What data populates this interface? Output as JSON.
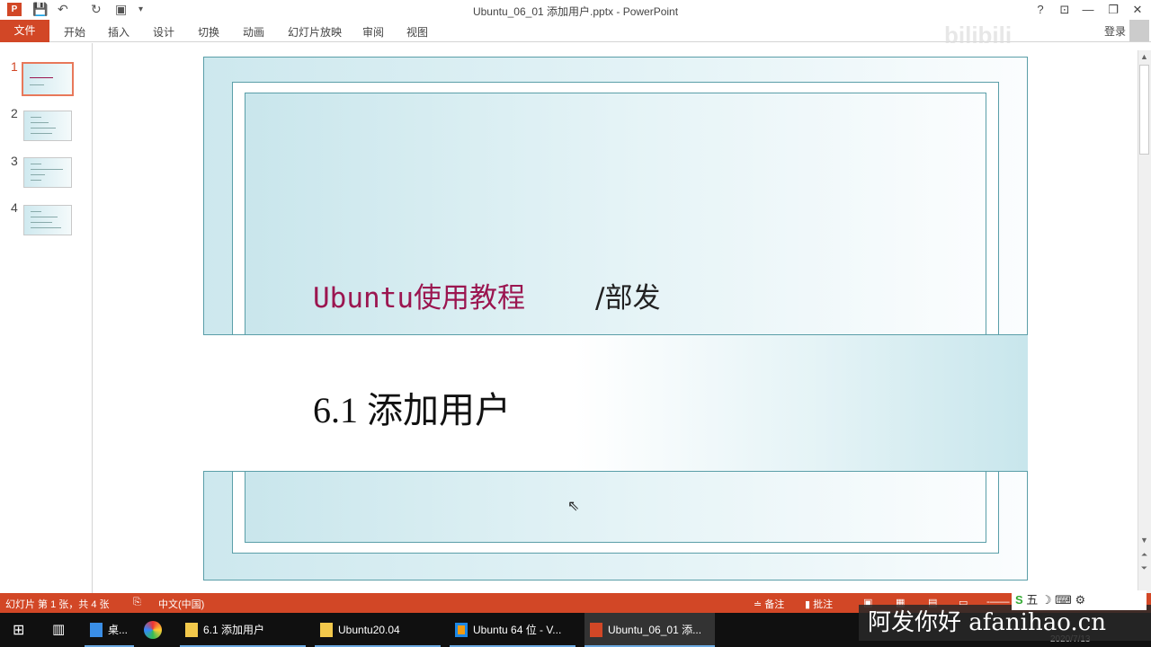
{
  "window": {
    "title": "Ubuntu_06_01 添加用户.pptx - PowerPoint",
    "help": "?",
    "minimize": "—",
    "restore": "❐",
    "close": "✕",
    "ribbon_display": "⊡"
  },
  "quick_access": {
    "save": "💾",
    "undo": "↶",
    "redo": "↻",
    "present": "▣",
    "more": "▾"
  },
  "ribbon": {
    "tabs": [
      "文件",
      "开始",
      "插入",
      "设计",
      "切换",
      "动画",
      "幻灯片放映",
      "审阅",
      "视图"
    ],
    "signin": "登录"
  },
  "thumbnails": [
    "1",
    "2",
    "3",
    "4"
  ],
  "slide": {
    "title": "Ubuntu使用教程",
    "author": "/部发",
    "subtitle": "6.1 添加用户"
  },
  "status": {
    "slide_info": "幻灯片 第 1 张，共 4 张",
    "language": "中文(中国)",
    "notes": "备注",
    "comments": "批注"
  },
  "taskbar": {
    "items": [
      "桌...",
      "6.1 添加用户",
      "Ubuntu20.04",
      "Ubuntu 64 位 - V...",
      "Ubuntu_06_01 添..."
    ],
    "clock": "2020/7/13"
  },
  "watermark": {
    "text": "阿发你好 afanihao.cn",
    "bili": "bilibili"
  },
  "colors": {
    "accent": "#d24726",
    "title": "#9b1650"
  }
}
